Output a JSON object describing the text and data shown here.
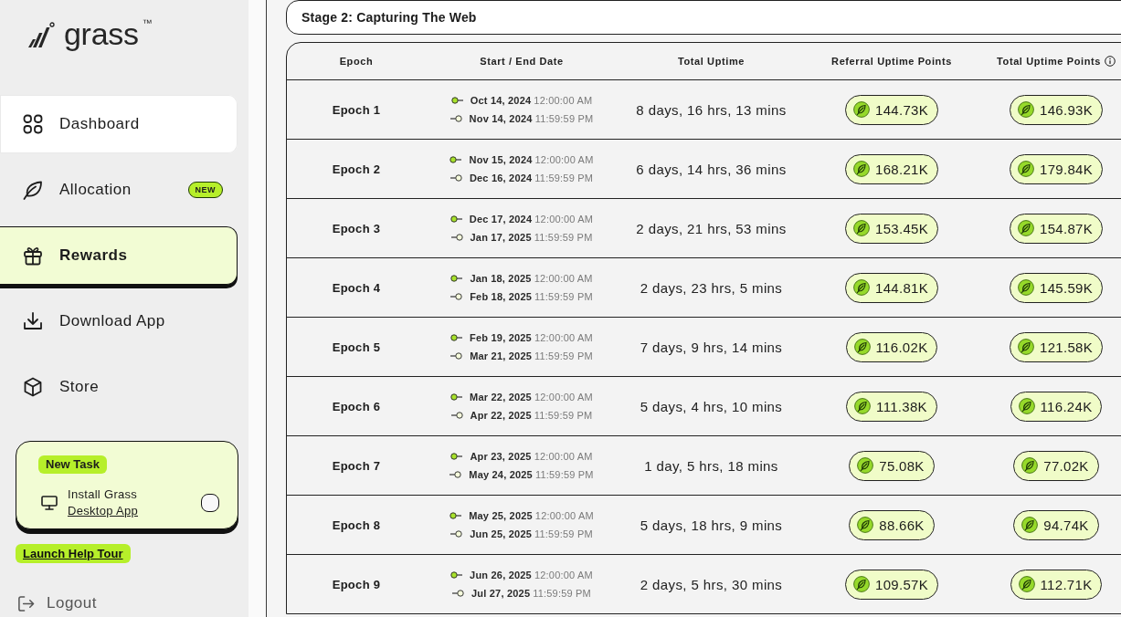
{
  "sidebar": {
    "logo": {
      "name": "grass",
      "trademark": "™"
    },
    "nav": [
      {
        "label": "Dashboard",
        "selected": false,
        "hovered": true
      },
      {
        "label": "Allocation",
        "selected": false,
        "hovered": false,
        "badge": "NEW"
      },
      {
        "label": "Rewards",
        "selected": true,
        "hovered": false
      },
      {
        "label": "Download App",
        "selected": false,
        "hovered": false
      },
      {
        "label": "Store",
        "selected": false,
        "hovered": false
      }
    ],
    "task_card": {
      "badge": "New Task",
      "title": "Install Grass",
      "link": "Desktop App",
      "checked": false
    },
    "help_tour": "Launch Help Tour",
    "logout": "Logout"
  },
  "main": {
    "stage_title": "Stage 2: Capturing The Web",
    "table": {
      "columns": [
        {
          "label": "Epoch",
          "info": false
        },
        {
          "label": "Start / End Date",
          "info": false
        },
        {
          "label": "Total Uptime",
          "info": false
        },
        {
          "label": "Referral Uptime Points",
          "info": false
        },
        {
          "label": "Total Uptime Points",
          "info": true
        }
      ],
      "rows": [
        {
          "epoch": "Epoch 1",
          "start_date": "Oct 14, 2024",
          "start_time": "12:00:00 AM",
          "end_date": "Nov 14, 2024",
          "end_time": "11:59:59 PM",
          "uptime": "8 days, 16 hrs, 13 mins",
          "referral_points": "144.73K",
          "total_points": "146.93K"
        },
        {
          "epoch": "Epoch 2",
          "start_date": "Nov 15, 2024",
          "start_time": "12:00:00 AM",
          "end_date": "Dec 16, 2024",
          "end_time": "11:59:59 PM",
          "uptime": "6 days, 14 hrs, 36 mins",
          "referral_points": "168.21K",
          "total_points": "179.84K"
        },
        {
          "epoch": "Epoch 3",
          "start_date": "Dec 17, 2024",
          "start_time": "12:00:00 AM",
          "end_date": "Jan 17, 2025",
          "end_time": "11:59:59 PM",
          "uptime": "2 days, 21 hrs, 53 mins",
          "referral_points": "153.45K",
          "total_points": "154.87K"
        },
        {
          "epoch": "Epoch 4",
          "start_date": "Jan 18, 2025",
          "start_time": "12:00:00 AM",
          "end_date": "Feb 18, 2025",
          "end_time": "11:59:59 PM",
          "uptime": "2 days, 23 hrs, 5 mins",
          "referral_points": "144.81K",
          "total_points": "145.59K"
        },
        {
          "epoch": "Epoch 5",
          "start_date": "Feb 19, 2025",
          "start_time": "12:00:00 AM",
          "end_date": "Mar 21, 2025",
          "end_time": "11:59:59 PM",
          "uptime": "7 days, 9 hrs, 14 mins",
          "referral_points": "116.02K",
          "total_points": "121.58K"
        },
        {
          "epoch": "Epoch 6",
          "start_date": "Mar 22, 2025",
          "start_time": "12:00:00 AM",
          "end_date": "Apr 22, 2025",
          "end_time": "11:59:59 PM",
          "uptime": "5 days, 4 hrs, 10 mins",
          "referral_points": "111.38K",
          "total_points": "116.24K"
        },
        {
          "epoch": "Epoch 7",
          "start_date": "Apr 23, 2025",
          "start_time": "12:00:00 AM",
          "end_date": "May 24, 2025",
          "end_time": "11:59:59 PM",
          "uptime": "1 day, 5 hrs, 18 mins",
          "referral_points": "75.08K",
          "total_points": "77.02K"
        },
        {
          "epoch": "Epoch 8",
          "start_date": "May 25, 2025",
          "start_time": "12:00:00 AM",
          "end_date": "Jun 25, 2025",
          "end_time": "11:59:59 PM",
          "uptime": "5 days, 18 hrs, 9 mins",
          "referral_points": "88.66K",
          "total_points": "94.74K"
        },
        {
          "epoch": "Epoch 9",
          "start_date": "Jun 26, 2025",
          "start_time": "12:00:00 AM",
          "end_date": "Jul 27, 2025",
          "end_time": "11:59:59 PM",
          "uptime": "2 days, 5 hrs, 30 mins",
          "referral_points": "109.57K",
          "total_points": "112.71K"
        }
      ]
    }
  }
}
